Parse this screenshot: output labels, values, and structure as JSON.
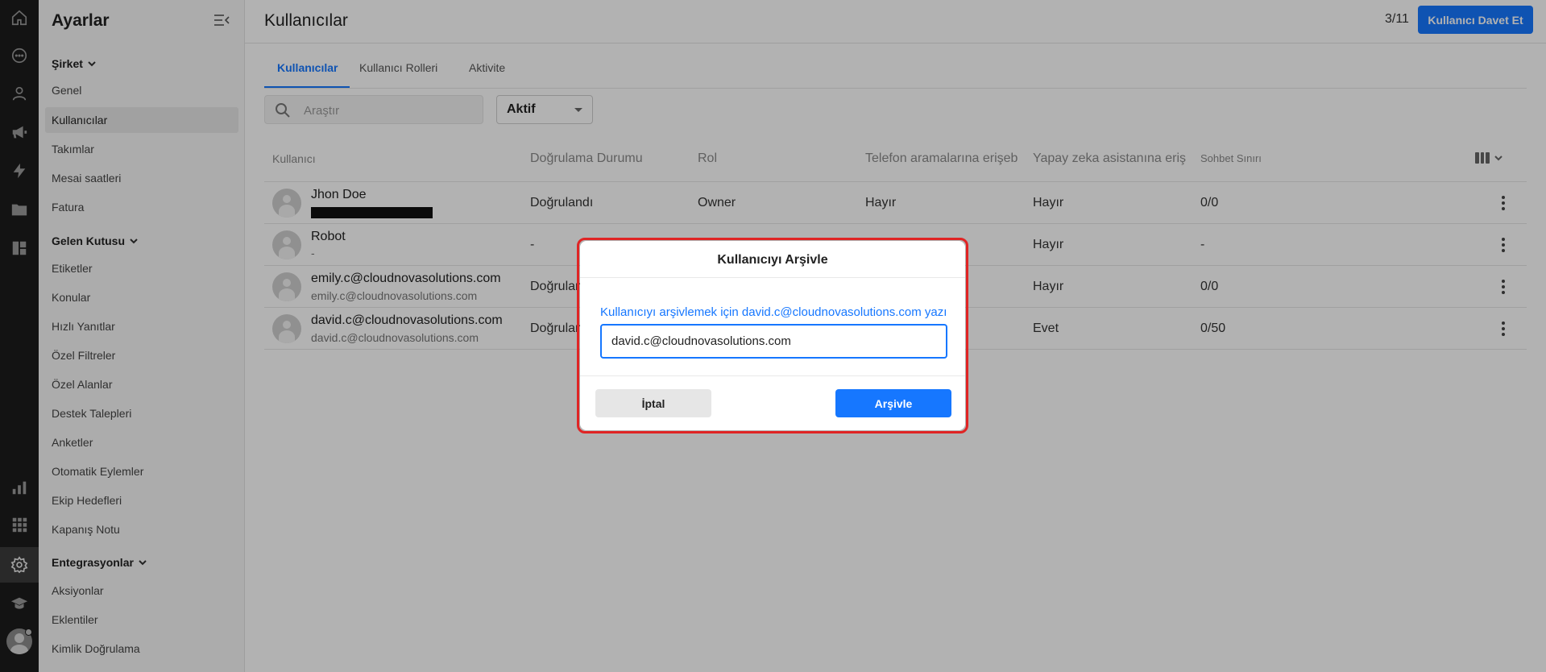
{
  "rail": {
    "icons": [
      "home-icon",
      "chat-icon",
      "contacts-icon",
      "megaphone-icon",
      "bolt-icon",
      "folder-user-icon",
      "dashboard-icon",
      "reports-icon",
      "apps-grid-icon",
      "gear-icon",
      "academy-icon",
      "user-avatar-icon"
    ],
    "active": "gear-icon"
  },
  "sidebar": {
    "title": "Ayarlar",
    "sections": [
      {
        "label": "Şirket",
        "items": [
          "Genel",
          "Kullanıcılar",
          "Takımlar",
          "Mesai saatleri",
          "Fatura"
        ]
      },
      {
        "label": "Gelen Kutusu",
        "items": [
          "Etiketler",
          "Konular",
          "Hızlı Yanıtlar",
          "Özel Filtreler",
          "Özel Alanlar",
          "Destek Talepleri",
          "Anketler",
          "Otomatik Eylemler",
          "Ekip Hedefleri",
          "Kapanış Notu"
        ]
      },
      {
        "label": "Entegrasyonlar",
        "items": [
          "Aksiyonlar",
          "Eklentiler",
          "Kimlik Doğrulama"
        ]
      }
    ],
    "active_item": "Kullanıcılar"
  },
  "header": {
    "title": "Kullanıcılar",
    "counter": "3/11",
    "invite_label": "Kullanıcı Davet Et"
  },
  "tabs": [
    "Kullanıcılar",
    "Kullanıcı Rolleri",
    "Aktivite"
  ],
  "filters": {
    "search_placeholder": "Araştır",
    "status_value": "Aktif"
  },
  "table": {
    "headers": [
      "Kullanıcı",
      "Doğrulama Durumu",
      "Rol",
      "Telefon aramalarına erişebilir",
      "Yapay zeka asistanına erişebilir",
      "Sohbet Sınırı"
    ],
    "rows": [
      {
        "name": "Jhon Doe",
        "sub": "",
        "redacted": true,
        "verification": "Doğrulandı",
        "role": "Owner",
        "phone": "Hayır",
        "ai": "Hayır",
        "chat_limit": "0/0"
      },
      {
        "name": "Robot",
        "sub": "-",
        "redacted": false,
        "verification": "-",
        "role": "",
        "phone": "",
        "ai": "Hayır",
        "chat_limit": "-"
      },
      {
        "name": "emily.c@cloudnovasolutions.com",
        "sub": "emily.c@cloudnovasolutions.com",
        "redacted": false,
        "verification": "Doğrulandı",
        "role": "",
        "phone": "",
        "ai": "Hayır",
        "chat_limit": "0/0"
      },
      {
        "name": "david.c@cloudnovasolutions.com",
        "sub": "david.c@cloudnovasolutions.com",
        "redacted": false,
        "verification": "Doğrulandı",
        "role": "",
        "phone": "",
        "ai": "Evet",
        "chat_limit": "0/50"
      }
    ]
  },
  "modal": {
    "title": "Kullanıcıyı Arşivle",
    "message": "Kullanıcıyı arşivlemek için david.c@cloudnovasolutions.com yazın",
    "input_value": "david.c@cloudnovasolutions.com",
    "cancel_label": "İptal",
    "confirm_label": "Arşivle"
  },
  "colors": {
    "accent": "#1677ff",
    "rail_bg": "#1c1c1c",
    "highlight_border": "#e02424"
  }
}
